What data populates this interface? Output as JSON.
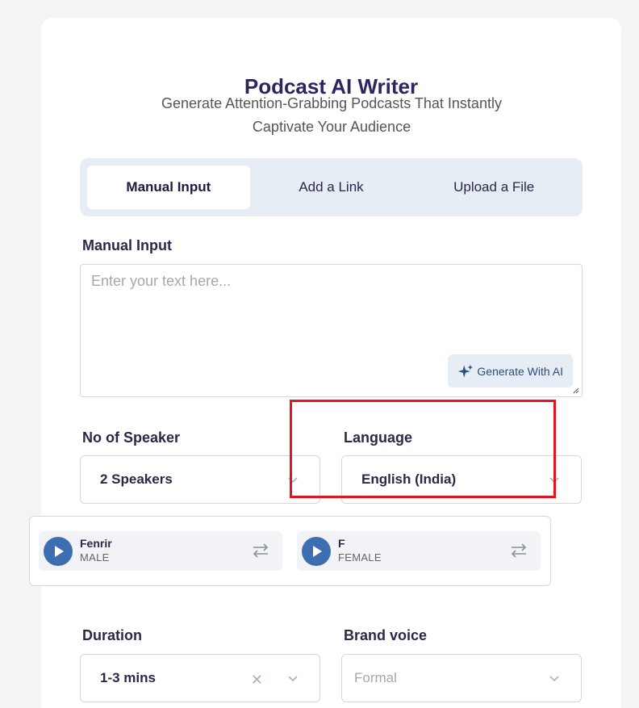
{
  "header": {
    "title": "Podcast AI Writer",
    "subtitle": "Generate Attention-Grabbing Podcasts That Instantly Captivate Your Audience"
  },
  "tabs": [
    {
      "label": "Manual Input",
      "active": true
    },
    {
      "label": "Add a Link",
      "active": false
    },
    {
      "label": "Upload a File",
      "active": false
    }
  ],
  "manual_input": {
    "label": "Manual Input",
    "placeholder": "Enter your text here...",
    "value": "",
    "generate_button": "Generate With AI"
  },
  "speakers": {
    "label": "No of Speaker",
    "selected": "2 Speakers"
  },
  "language": {
    "label": "Language",
    "selected": "English (India)"
  },
  "voices": [
    {
      "name": "Fenrir",
      "gender": "MALE"
    },
    {
      "name": "F",
      "gender": "FEMALE"
    }
  ],
  "duration": {
    "label": "Duration",
    "selected": "1-3 mins"
  },
  "brand_voice": {
    "label": "Brand voice",
    "placeholder": "Formal"
  },
  "colors": {
    "accent": "#3d6eb0",
    "title": "#2a2660",
    "highlight": "#e3141e"
  }
}
